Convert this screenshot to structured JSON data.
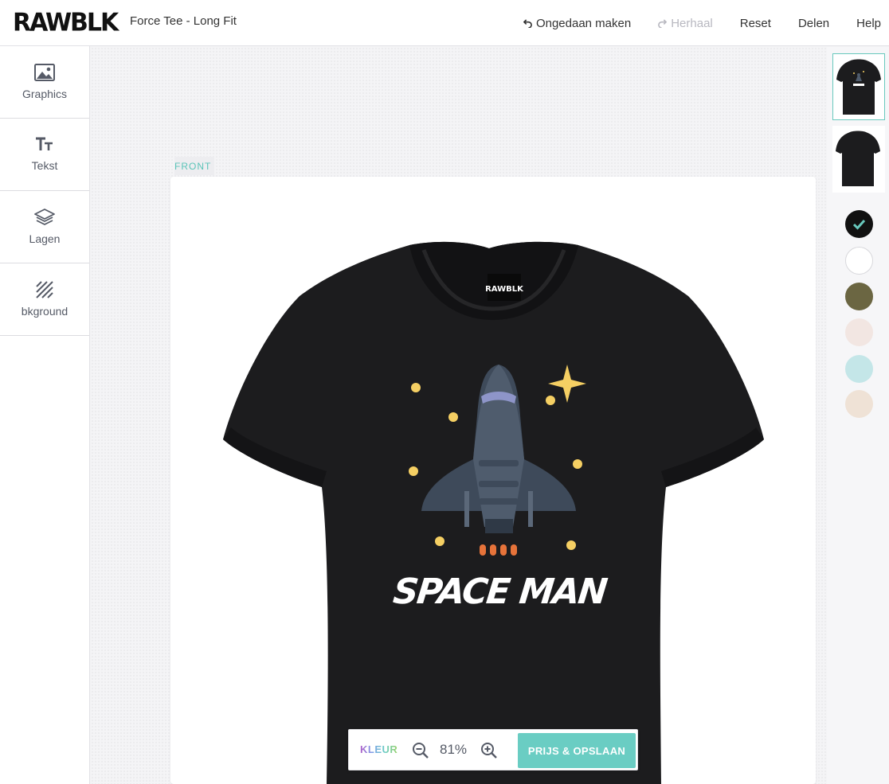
{
  "header": {
    "logo_text": "RAWBLK",
    "product_title": "Force Tee - Long Fit",
    "undo_label": "Ongedaan maken",
    "redo_label": "Herhaal",
    "reset_label": "Reset",
    "share_label": "Delen",
    "help_label": "Help"
  },
  "sidebar": {
    "items": [
      {
        "label": "Graphics",
        "icon": "image-icon"
      },
      {
        "label": "Tekst",
        "icon": "text-icon"
      },
      {
        "label": "Lagen",
        "icon": "layers-icon"
      },
      {
        "label": "bkground",
        "icon": "hatch-icon"
      }
    ]
  },
  "canvas": {
    "view_label": "FRONT",
    "neck_label": "RAWBLK",
    "design_text": "SPACE MAN"
  },
  "views": [
    {
      "name": "front",
      "selected": true
    },
    {
      "name": "back",
      "selected": false
    }
  ],
  "colors": {
    "accent": "#68c9bd",
    "swatches": [
      "#111111",
      "#ffffff",
      "#6b6642",
      "#f2e6e2",
      "#c4e6e8",
      "#efe2d6"
    ],
    "selected_swatch": 0
  },
  "toolbar": {
    "color_label": "KLEUR",
    "zoom_level": "81%",
    "price_save_label": "PRIJS & OPSLAAN"
  }
}
